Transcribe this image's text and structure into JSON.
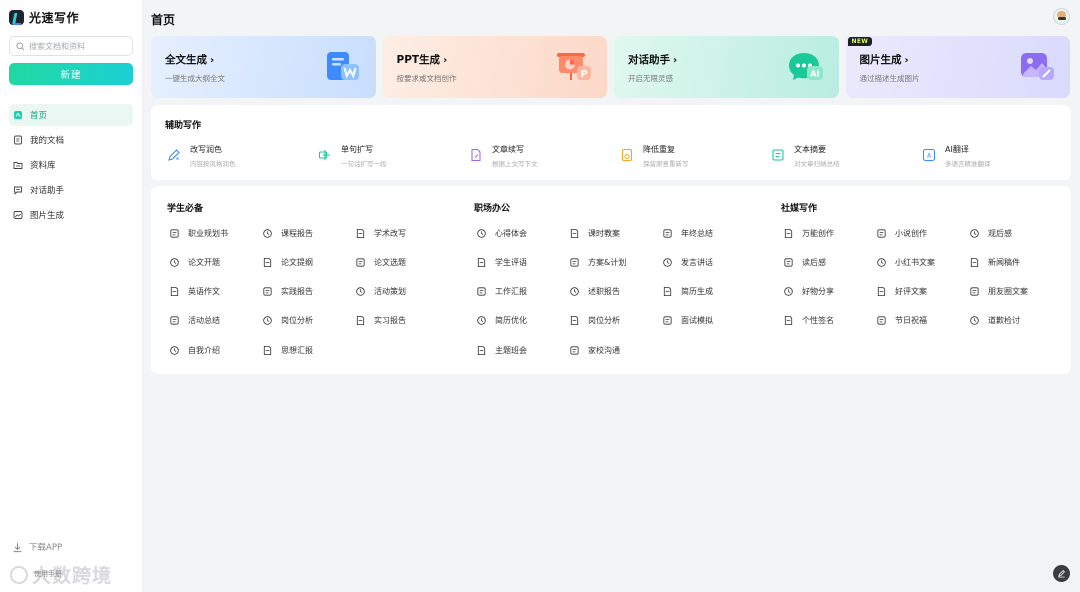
{
  "app": {
    "name": "光速写作"
  },
  "sidebar": {
    "search_placeholder": "搜索文档和资料",
    "new_label": "新建",
    "items": [
      {
        "label": "首页",
        "icon": "home-icon",
        "active": true
      },
      {
        "label": "我的文档",
        "icon": "document-icon",
        "active": false
      },
      {
        "label": "资料库",
        "icon": "folder-icon",
        "active": false
      },
      {
        "label": "对话助手",
        "icon": "chat-icon",
        "active": false
      },
      {
        "label": "图片生成",
        "icon": "image-icon",
        "active": false
      }
    ],
    "download_label": "下载APP",
    "watermark": "大数跨境",
    "watermark_small": "使用手册"
  },
  "header": {
    "title": "首页"
  },
  "cards": [
    {
      "title": "全文生成",
      "desc": "一键生成大纲全文",
      "icon": "word-doc-icon"
    },
    {
      "title": "PPT生成",
      "desc": "按要求或文档创作",
      "icon": "ppt-icon"
    },
    {
      "title": "对话助手",
      "desc": "开启无限灵感",
      "icon": "ai-chat-icon"
    },
    {
      "title": "图片生成",
      "desc": "通过描述生成图片",
      "icon": "picture-icon",
      "badge": "NEW"
    }
  ],
  "aux": {
    "title": "辅助写作",
    "items": [
      {
        "name": "改写润色",
        "desc": "内容按风格润色",
        "icon": "rewrite-icon"
      },
      {
        "name": "单句扩写",
        "desc": "一句话扩写一段",
        "icon": "expand-icon"
      },
      {
        "name": "文章续写",
        "desc": "根据上文写下文",
        "icon": "continue-icon"
      },
      {
        "name": "降低重复",
        "desc": "保留原意重新写",
        "icon": "dedupe-icon"
      },
      {
        "name": "文本摘要",
        "desc": "对文章归纳总结",
        "icon": "summary-icon"
      },
      {
        "name": "AI翻译",
        "desc": "多语言精准翻译",
        "icon": "translate-icon"
      }
    ]
  },
  "columns": [
    {
      "title": "学生必备",
      "tools": [
        [
          "职业规划书",
          "课程报告",
          "学术改写"
        ],
        [
          "论文开题",
          "论文提纲",
          "论文选题"
        ],
        [
          "英语作文",
          "实践报告",
          "活动策划"
        ],
        [
          "活动总结",
          "岗位分析",
          "实习报告"
        ],
        [
          "自我介绍",
          "思想汇报"
        ]
      ]
    },
    {
      "title": "职场办公",
      "tools": [
        [
          "心得体会",
          "课时教案",
          "年终总结"
        ],
        [
          "学生评语",
          "方案&计划",
          "发言讲话"
        ],
        [
          "工作汇报",
          "述职报告",
          "简历生成"
        ],
        [
          "简历优化",
          "岗位分析",
          "面试模拟"
        ],
        [
          "主题班会",
          "家校沟通"
        ]
      ]
    },
    {
      "title": "社媒写作",
      "tools": [
        [
          "万能创作",
          "小说创作",
          "观后感"
        ],
        [
          "读后感",
          "小红书文案",
          "新闻稿件"
        ],
        [
          "好物分享",
          "好评文案",
          "朋友圈文案"
        ],
        [
          "个性签名",
          "节日祝福",
          "道歉检讨"
        ]
      ]
    }
  ],
  "colors": {
    "accent": "#1ccfb0",
    "active_bg": "#eaf7f3",
    "active_text": "#14a27a"
  }
}
